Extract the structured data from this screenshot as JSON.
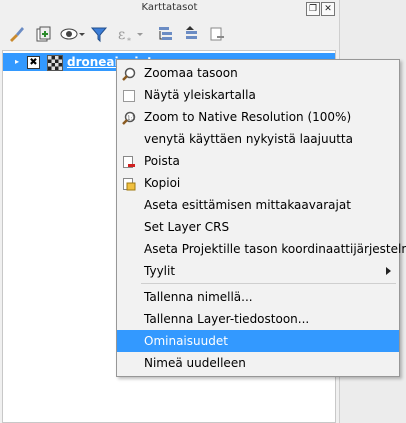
{
  "window": {
    "title": "Karttatasot",
    "restore_glyph": "❐",
    "close_glyph": "✕"
  },
  "toolbar": {
    "tools": [
      {
        "icon": "brush-style-icon"
      },
      {
        "icon": "add-group-icon"
      },
      {
        "icon": "eye-visibility-icon"
      },
      {
        "icon": "filter-icon"
      },
      {
        "icon": "expression-filter-icon"
      },
      {
        "icon": "expand-all-icon"
      },
      {
        "icon": "collapse-all-icon"
      },
      {
        "icon": "remove-layer-icon"
      }
    ]
  },
  "layer_tree": {
    "layer": {
      "name": "droneainsigts",
      "checked": true,
      "check_glyph": "✖",
      "expander_glyph": "▸",
      "icon": "raster-layer-icon"
    }
  },
  "context_menu": {
    "items": [
      {
        "label": "Zoomaa tasoon",
        "icon": "zoom-to-layer-icon"
      },
      {
        "label": "Näytä yleiskartalla",
        "icon": "checkbox-icon"
      },
      {
        "label": "Zoom to Native Resolution (100%)",
        "icon": "zoom-native-icon"
      },
      {
        "label": "venytä käyttäen nykyistä laajuutta",
        "icon": ""
      },
      {
        "label": "Poista",
        "icon": "remove-icon"
      },
      {
        "label": "Kopioi",
        "icon": "copy-icon"
      },
      {
        "label": "Aseta esittämisen mittakaavarajat",
        "icon": ""
      },
      {
        "label": "Set Layer CRS",
        "icon": ""
      },
      {
        "label": "Aseta Projektille tason koordinaattijärjestelmä",
        "icon": ""
      },
      {
        "label": "Tyylit",
        "icon": "",
        "submenu": true
      },
      {
        "label": "Tallenna nimellä...",
        "icon": ""
      },
      {
        "label": "Tallenna Layer-tiedostoon...",
        "icon": ""
      },
      {
        "label": "Ominaisuudet",
        "icon": "",
        "highlighted": true
      },
      {
        "label": "Nimeä uudelleen",
        "icon": ""
      }
    ]
  },
  "colors": {
    "selection": "#3399ff",
    "panel_background": "#f0f0f0",
    "tree_background": "#ffffff"
  }
}
